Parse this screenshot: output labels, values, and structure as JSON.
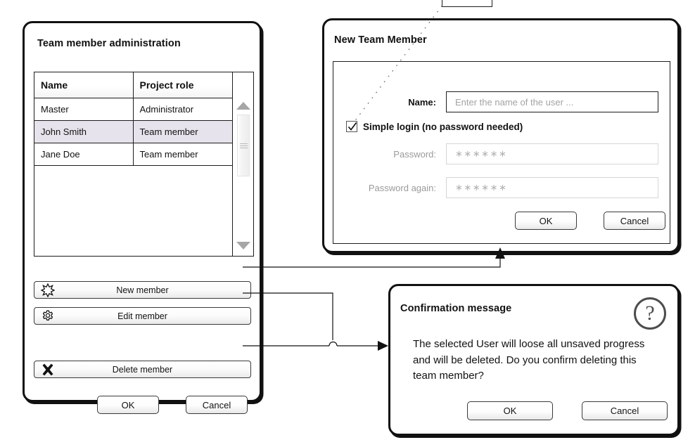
{
  "admin_panel": {
    "title": "Team member administration",
    "table": {
      "columns": [
        "Name",
        "Project role"
      ],
      "rows": [
        {
          "name": "Master",
          "role": "Administrator",
          "selected": false
        },
        {
          "name": "John Smith",
          "role": "Team member",
          "selected": true
        },
        {
          "name": "Jane Doe",
          "role": "Team member",
          "selected": false
        }
      ]
    },
    "scrollbar": {
      "up_icon": "scroll-up-arrow",
      "down_icon": "scroll-down-arrow"
    },
    "actions": [
      {
        "label": "New member",
        "icon": "star-burst-icon"
      },
      {
        "label": "Edit member",
        "icon": "gear-icon"
      },
      {
        "label": "Delete member",
        "icon": "cross-icon"
      }
    ],
    "ok_label": "OK",
    "cancel_label": "Cancel"
  },
  "new_member_dialog": {
    "title": "New Team Member",
    "name_label": "Name:",
    "name_placeholder": "Enter the name of the user ...",
    "name_value": "",
    "checkbox_label": "Simple login (no password needed)",
    "checkbox_checked": true,
    "password_label": "Password:",
    "password_value": "∗∗∗∗∗∗",
    "password_again_label": "Password again:",
    "password_again_value": "∗∗∗∗∗∗",
    "ok_label": "OK",
    "cancel_label": "Cancel"
  },
  "confirmation_dialog": {
    "title": "Confirmation message",
    "icon": "question-mark-icon",
    "icon_glyph": "?",
    "message": "The selected User will loose all unsaved progress and will be deleted. Do you confirm deleting this team member?",
    "ok_label": "OK",
    "cancel_label": "Cancel"
  },
  "colors": {
    "frame": "#111111",
    "selected_row": "#e7e3ec",
    "disabled_text": "#b3b3b3",
    "scroll_arrow": "#a6a6a6"
  }
}
